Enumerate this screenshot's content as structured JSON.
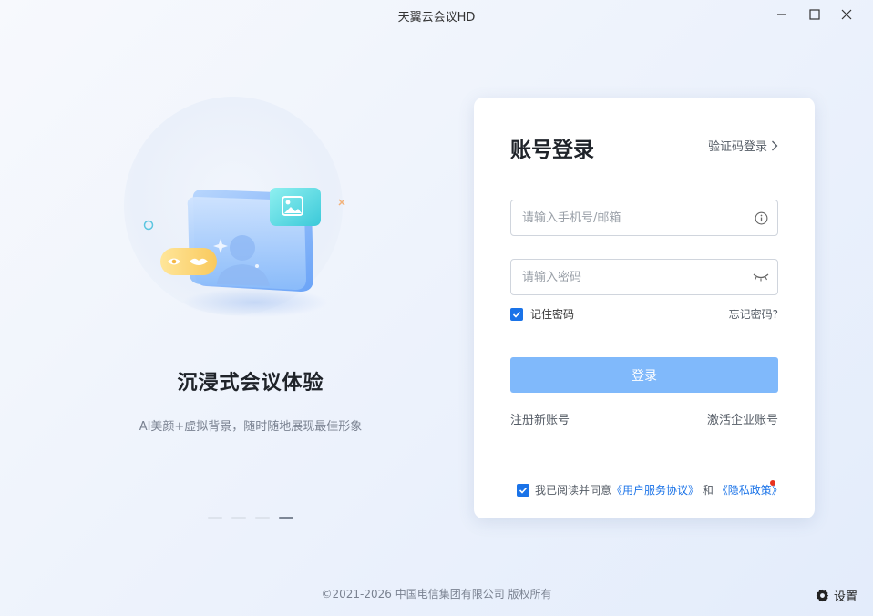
{
  "window": {
    "title": "天翼云会议HD"
  },
  "left": {
    "slogan_title": "沉浸式会议体验",
    "slogan_subtitle": "AI美颜+虚拟背景，随时随地展现最佳形象",
    "carousel_total": 4,
    "carousel_active": 4
  },
  "login": {
    "title": "账号登录",
    "switch_label": "验证码登录",
    "phone_placeholder": "请输入手机号/邮箱",
    "phone_value": "",
    "password_placeholder": "请输入密码",
    "password_value": "",
    "remember_label": "记住密码",
    "remember_checked": true,
    "forgot_label": "忘记密码?",
    "submit_label": "登录",
    "register_label": "注册新账号",
    "activate_label": "激活企业账号",
    "agree_prefix": "我已阅读并同意",
    "agree_link_terms": "《用户服务协议》",
    "agree_and": "和",
    "agree_link_privacy": "《隐私政策》",
    "agree_checked": true
  },
  "footer": {
    "copyright": "©2021-2026 中国电信集团有限公司 版权所有",
    "settings_label": "设置"
  },
  "colors": {
    "primary": "#1a73e8",
    "login_button": "#80b9fb",
    "notice_dot": "#e8321f"
  }
}
